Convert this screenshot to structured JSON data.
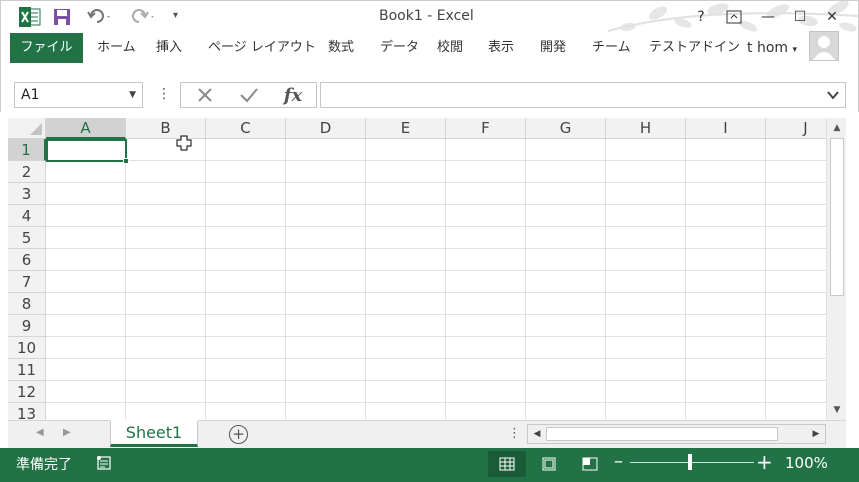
{
  "window": {
    "title": "Book1 - Excel",
    "help_label": "?",
    "minimize_label": "—",
    "maximize_label": "☐",
    "close_label": "✕"
  },
  "quick_access": {
    "icons": [
      "excel-logo",
      "save-icon",
      "undo-icon",
      "redo-icon",
      "customize-icon"
    ]
  },
  "ribbon": {
    "tabs": [
      "ファイル",
      "ホーム",
      "挿入",
      "ページ レイアウト",
      "数式",
      "データ",
      "校閲",
      "表示",
      "開発",
      "チーム",
      "テストアドイン"
    ],
    "user": "t hom",
    "accent": "#217346"
  },
  "formula_bar": {
    "name_box": "A1",
    "formula": ""
  },
  "grid": {
    "columns": [
      "A",
      "B",
      "C",
      "D",
      "E",
      "F",
      "G",
      "H",
      "I",
      "J"
    ],
    "rows": [
      "1",
      "2",
      "3",
      "4",
      "5",
      "6",
      "7",
      "8",
      "9",
      "10",
      "11",
      "12",
      "13"
    ],
    "active_cell": "A1",
    "cell_values": {}
  },
  "sheets": {
    "tabs": [
      "Sheet1"
    ],
    "active": "Sheet1"
  },
  "status": {
    "ready": "準備完了",
    "zoom": "100%"
  }
}
